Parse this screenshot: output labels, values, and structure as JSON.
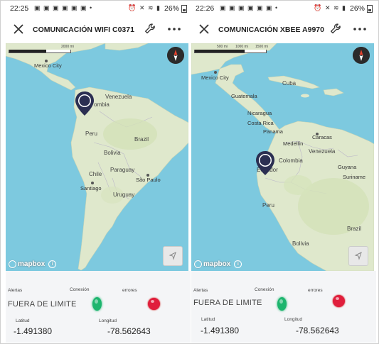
{
  "colors": {
    "water": "#7dc9df",
    "land": "#dfe8cc",
    "accent_green": "#1db56e",
    "accent_red": "#e01e3c",
    "pin": "#2b2f52"
  },
  "left": {
    "status": {
      "time": "22:25",
      "battery": "26%"
    },
    "title": "COMUNICACIÓN WIFI C0371",
    "map": {
      "scale_label": "2000 mi",
      "places": {
        "mexico_city": "Mexico City",
        "venezuela": "Venezuela",
        "colombia": "ombia",
        "peru": "Peru",
        "brazil": "Brazil",
        "bolivia": "Bolivia",
        "paraguay": "Paraguay",
        "chile": "Chile",
        "santiago": "Santiago",
        "sao_paulo": "São Paulo",
        "uruguay": "Uruguay"
      },
      "attribution": "mapbox"
    },
    "data": {
      "alerts_label": "Alertas",
      "connection_label": "Conexión",
      "errors_label": "errores",
      "alerts_value": "FUERA DE LIMITE",
      "lat_label": "Latitud",
      "lon_label": "Longitud",
      "lat_value": "-1.491380",
      "lon_value": "-78.562643"
    }
  },
  "right": {
    "status": {
      "time": "22:26",
      "battery": "26%"
    },
    "title": "COMUNICACIÓN XBEE A9970",
    "map": {
      "scale_labels": [
        "500 mi",
        "1000 mi",
        "1500 mi"
      ],
      "places": {
        "mexico_city": "Mexico City",
        "cuba": "Cuba",
        "guatemala": "Guatemala",
        "nicaragua": "Nicaragua",
        "costa_rica": "Costa Rica",
        "panama": "Panama",
        "caracas": "Caracas",
        "medellin": "Medellín",
        "venezuela": "Venezuela",
        "colombia": "Colombia",
        "guyana": "Guyana",
        "suriname": "Suriname",
        "ecuador": "Ecuador",
        "peru": "Peru",
        "brazil": "Brazil",
        "bolivia": "Bolivia"
      },
      "attribution": "mapbox"
    },
    "data": {
      "alerts_label": "Alertas",
      "connection_label": "Conexión",
      "errors_label": "errores",
      "alerts_value": "FUERA DE LIMITE",
      "lat_label": "Latitud",
      "lon_label": "Longitud",
      "lat_value": "-1.491380",
      "lon_value": "-78.562643"
    }
  }
}
